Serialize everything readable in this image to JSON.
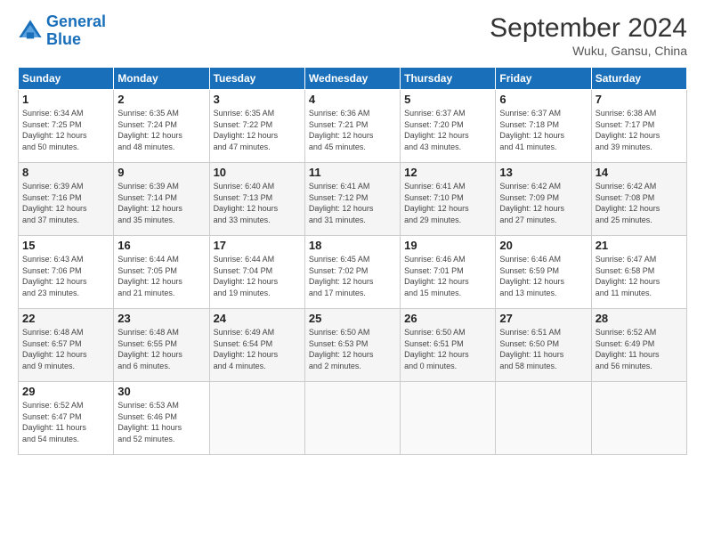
{
  "header": {
    "logo_line1": "General",
    "logo_line2": "Blue",
    "month": "September 2024",
    "location": "Wuku, Gansu, China"
  },
  "weekdays": [
    "Sunday",
    "Monday",
    "Tuesday",
    "Wednesday",
    "Thursday",
    "Friday",
    "Saturday"
  ],
  "weeks": [
    [
      {
        "day": "1",
        "info": "Sunrise: 6:34 AM\nSunset: 7:25 PM\nDaylight: 12 hours\nand 50 minutes."
      },
      {
        "day": "2",
        "info": "Sunrise: 6:35 AM\nSunset: 7:24 PM\nDaylight: 12 hours\nand 48 minutes."
      },
      {
        "day": "3",
        "info": "Sunrise: 6:35 AM\nSunset: 7:22 PM\nDaylight: 12 hours\nand 47 minutes."
      },
      {
        "day": "4",
        "info": "Sunrise: 6:36 AM\nSunset: 7:21 PM\nDaylight: 12 hours\nand 45 minutes."
      },
      {
        "day": "5",
        "info": "Sunrise: 6:37 AM\nSunset: 7:20 PM\nDaylight: 12 hours\nand 43 minutes."
      },
      {
        "day": "6",
        "info": "Sunrise: 6:37 AM\nSunset: 7:18 PM\nDaylight: 12 hours\nand 41 minutes."
      },
      {
        "day": "7",
        "info": "Sunrise: 6:38 AM\nSunset: 7:17 PM\nDaylight: 12 hours\nand 39 minutes."
      }
    ],
    [
      {
        "day": "8",
        "info": "Sunrise: 6:39 AM\nSunset: 7:16 PM\nDaylight: 12 hours\nand 37 minutes."
      },
      {
        "day": "9",
        "info": "Sunrise: 6:39 AM\nSunset: 7:14 PM\nDaylight: 12 hours\nand 35 minutes."
      },
      {
        "day": "10",
        "info": "Sunrise: 6:40 AM\nSunset: 7:13 PM\nDaylight: 12 hours\nand 33 minutes."
      },
      {
        "day": "11",
        "info": "Sunrise: 6:41 AM\nSunset: 7:12 PM\nDaylight: 12 hours\nand 31 minutes."
      },
      {
        "day": "12",
        "info": "Sunrise: 6:41 AM\nSunset: 7:10 PM\nDaylight: 12 hours\nand 29 minutes."
      },
      {
        "day": "13",
        "info": "Sunrise: 6:42 AM\nSunset: 7:09 PM\nDaylight: 12 hours\nand 27 minutes."
      },
      {
        "day": "14",
        "info": "Sunrise: 6:42 AM\nSunset: 7:08 PM\nDaylight: 12 hours\nand 25 minutes."
      }
    ],
    [
      {
        "day": "15",
        "info": "Sunrise: 6:43 AM\nSunset: 7:06 PM\nDaylight: 12 hours\nand 23 minutes."
      },
      {
        "day": "16",
        "info": "Sunrise: 6:44 AM\nSunset: 7:05 PM\nDaylight: 12 hours\nand 21 minutes."
      },
      {
        "day": "17",
        "info": "Sunrise: 6:44 AM\nSunset: 7:04 PM\nDaylight: 12 hours\nand 19 minutes."
      },
      {
        "day": "18",
        "info": "Sunrise: 6:45 AM\nSunset: 7:02 PM\nDaylight: 12 hours\nand 17 minutes."
      },
      {
        "day": "19",
        "info": "Sunrise: 6:46 AM\nSunset: 7:01 PM\nDaylight: 12 hours\nand 15 minutes."
      },
      {
        "day": "20",
        "info": "Sunrise: 6:46 AM\nSunset: 6:59 PM\nDaylight: 12 hours\nand 13 minutes."
      },
      {
        "day": "21",
        "info": "Sunrise: 6:47 AM\nSunset: 6:58 PM\nDaylight: 12 hours\nand 11 minutes."
      }
    ],
    [
      {
        "day": "22",
        "info": "Sunrise: 6:48 AM\nSunset: 6:57 PM\nDaylight: 12 hours\nand 9 minutes."
      },
      {
        "day": "23",
        "info": "Sunrise: 6:48 AM\nSunset: 6:55 PM\nDaylight: 12 hours\nand 6 minutes."
      },
      {
        "day": "24",
        "info": "Sunrise: 6:49 AM\nSunset: 6:54 PM\nDaylight: 12 hours\nand 4 minutes."
      },
      {
        "day": "25",
        "info": "Sunrise: 6:50 AM\nSunset: 6:53 PM\nDaylight: 12 hours\nand 2 minutes."
      },
      {
        "day": "26",
        "info": "Sunrise: 6:50 AM\nSunset: 6:51 PM\nDaylight: 12 hours\nand 0 minutes."
      },
      {
        "day": "27",
        "info": "Sunrise: 6:51 AM\nSunset: 6:50 PM\nDaylight: 11 hours\nand 58 minutes."
      },
      {
        "day": "28",
        "info": "Sunrise: 6:52 AM\nSunset: 6:49 PM\nDaylight: 11 hours\nand 56 minutes."
      }
    ],
    [
      {
        "day": "29",
        "info": "Sunrise: 6:52 AM\nSunset: 6:47 PM\nDaylight: 11 hours\nand 54 minutes."
      },
      {
        "day": "30",
        "info": "Sunrise: 6:53 AM\nSunset: 6:46 PM\nDaylight: 11 hours\nand 52 minutes."
      },
      {
        "day": "",
        "info": ""
      },
      {
        "day": "",
        "info": ""
      },
      {
        "day": "",
        "info": ""
      },
      {
        "day": "",
        "info": ""
      },
      {
        "day": "",
        "info": ""
      }
    ]
  ]
}
